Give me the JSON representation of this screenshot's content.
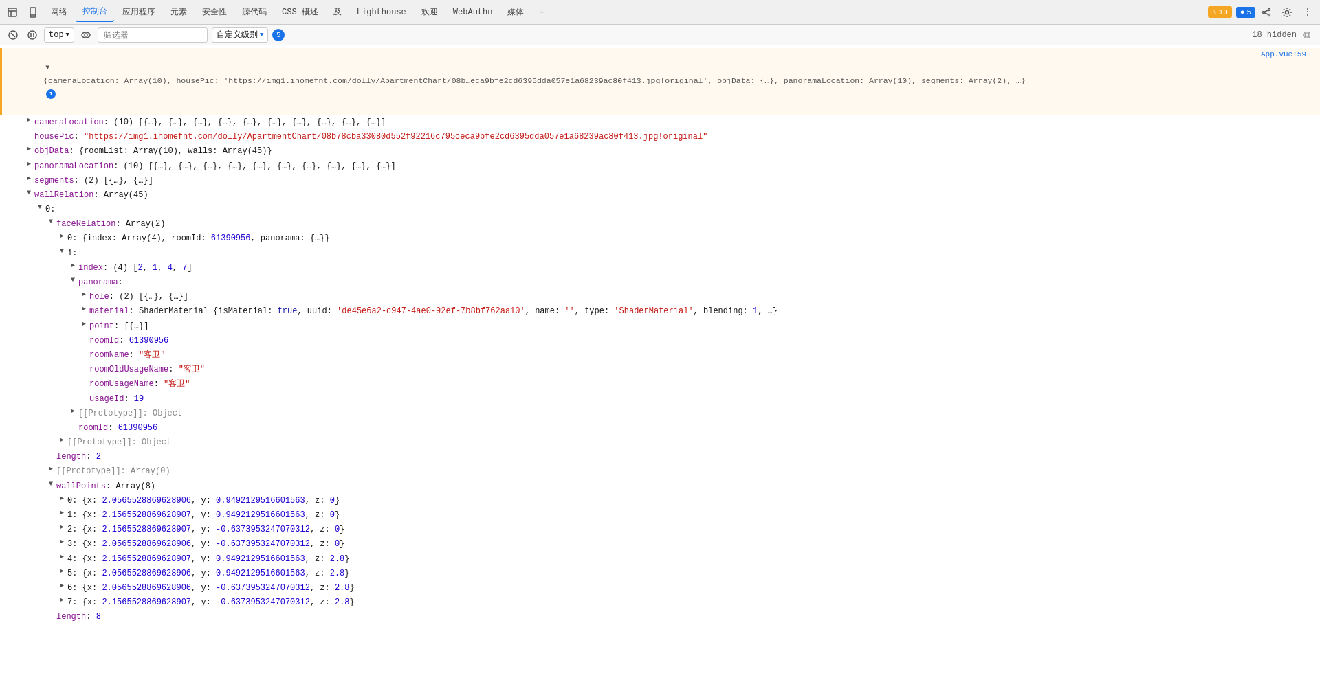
{
  "nav": {
    "items": [
      {
        "label": "网络",
        "active": false
      },
      {
        "label": "控制台",
        "active": true
      },
      {
        "label": "应用程序",
        "active": false
      },
      {
        "label": "元素",
        "active": false
      },
      {
        "label": "安全性",
        "active": false
      },
      {
        "label": "源代码",
        "active": false
      },
      {
        "label": "CSS 概述",
        "active": false
      },
      {
        "label": "及",
        "active": false
      },
      {
        "label": "Lighthouse",
        "active": false
      },
      {
        "label": "欢迎",
        "active": false
      },
      {
        "label": "WebAuthn",
        "active": false
      },
      {
        "label": "媒体",
        "active": false
      }
    ],
    "warning_count": "10",
    "error_count": "5",
    "hidden_count": "18 hidden"
  },
  "toolbar": {
    "top_label": "top",
    "filter_placeholder": "筛选器",
    "level_label": "自定义级别",
    "message_count": "5"
  },
  "source": {
    "link": "App.vue:59"
  },
  "console": {
    "object_summary": "{cameraLocation: Array(10), housePic: 'https://img1.ihomefnt.com/dolly/ApartmentChart/08b…eca9bfe2cd6395dda057e1a68239ac80f413.jpg!original', objData: {…}, panoramaLocation: Array(10), segments: Array(2), …}",
    "lines": [
      {
        "indent": 1,
        "toggle": "open",
        "text": "cameraLocation: (10) [{…}, {…}, {…}, {…}, {…}, {…}, {…}, {…}, {…}, {…}]",
        "key": "cameraLocation",
        "value": "(10) [{…}, {…}, {…}, {…}, {…}, {…}, {…}, {…}, {…}, {…}]"
      },
      {
        "indent": 1,
        "toggle": "none",
        "text": "housePic: \"https://img1.ihomefnt.com/dolly/ApartmentChart/08b78cba33080d552f92216c795ceca9bfe2cd6395dda057e1a68239ac80f413.jpg!original\""
      },
      {
        "indent": 1,
        "toggle": "open",
        "text": "objData: {roomList: Array(10), walls: Array(45)}"
      },
      {
        "indent": 1,
        "toggle": "open",
        "text": "panoramaLocation: (10) [{…}, {…}, {…}, {…}, {…}, {…}, {…}, {…}, {…}, {…}]"
      },
      {
        "indent": 1,
        "toggle": "open",
        "text": "segments: (2) [{…}, {…}]"
      },
      {
        "indent": 1,
        "toggle": "open",
        "text": "wallRelation: Array(45)"
      },
      {
        "indent": 2,
        "toggle": "open",
        "text": "0:"
      },
      {
        "indent": 3,
        "toggle": "open",
        "text": "faceRelation: Array(2)"
      },
      {
        "indent": 4,
        "toggle": "closed",
        "text": "0: {index: Array(4), roomId: 61390956, panorama: {…}}"
      },
      {
        "indent": 4,
        "toggle": "open",
        "text": "1:"
      },
      {
        "indent": 5,
        "toggle": "closed",
        "text": "index: (4) [2, 1, 4, 7]"
      },
      {
        "indent": 5,
        "toggle": "open",
        "text": "panorama:"
      },
      {
        "indent": 6,
        "toggle": "closed",
        "text": "hole: (2) [{…}, {…}]"
      },
      {
        "indent": 6,
        "toggle": "closed",
        "text": "material: ShaderMaterial {isMaterial: true, uuid: 'de45e6a2-c947-4ae0-92ef-7b8bf762aa10', name: '', type: 'ShaderMaterial', blending: 1, …}"
      },
      {
        "indent": 6,
        "toggle": "closed",
        "text": "point: [{…}]"
      },
      {
        "indent": 6,
        "toggle": "none",
        "text": "roomId: 61390956",
        "key": "roomId",
        "is_number": true,
        "number_val": "61390956"
      },
      {
        "indent": 6,
        "toggle": "none",
        "text": "roomName: \"客卫\"",
        "key": "roomName",
        "is_string": true,
        "string_val": "\"客卫\""
      },
      {
        "indent": 6,
        "toggle": "none",
        "text": "roomOldUsageName: \"客卫\"",
        "key": "roomOldUsageName",
        "is_string": true,
        "string_val": "\"客卫\""
      },
      {
        "indent": 6,
        "toggle": "none",
        "text": "roomUsageName: \"客卫\"",
        "key": "roomUsageName",
        "is_string": true,
        "string_val": "\"客卫\""
      },
      {
        "indent": 6,
        "toggle": "none",
        "text": "usageId: 19",
        "key": "usageId",
        "is_number": true,
        "number_val": "19"
      },
      {
        "indent": 5,
        "toggle": "closed",
        "text": "[[Prototype]]: Object"
      },
      {
        "indent": 5,
        "toggle": "none",
        "text": "roomId: 61390956",
        "key": "roomId",
        "is_number": true,
        "number_val": "61390956"
      },
      {
        "indent": 4,
        "toggle": "closed",
        "text": "[[Prototype]]: Object"
      },
      {
        "indent": 3,
        "toggle": "none",
        "text": "length: 2"
      },
      {
        "indent": 3,
        "toggle": "closed",
        "text": "[[Prototype]]: Array(0)"
      },
      {
        "indent": 3,
        "toggle": "open",
        "text": "wallPoints: Array(8)"
      },
      {
        "indent": 4,
        "toggle": "closed",
        "text": "0: {x: 2.0565528869628906, y: 0.9492129516601563, z: 0}"
      },
      {
        "indent": 4,
        "toggle": "closed",
        "text": "1: {x: 2.1565528869628907, y: 0.9492129516601563, z: 0}"
      },
      {
        "indent": 4,
        "toggle": "closed",
        "text": "2: {x: 2.1565528869628907, y: -0.6373953247070312, z: 0}"
      },
      {
        "indent": 4,
        "toggle": "closed",
        "text": "3: {x: 2.0565528869628906, y: -0.6373953247070312, z: 0}"
      },
      {
        "indent": 4,
        "toggle": "closed",
        "text": "4: {x: 2.1565528869628907, y: 0.9492129516601563, z: 2.8}"
      },
      {
        "indent": 4,
        "toggle": "closed",
        "text": "5: {x: 2.0565528869628906, y: 0.9492129516601563, z: 2.8}"
      },
      {
        "indent": 4,
        "toggle": "closed",
        "text": "6: {x: 2.0565528869628906, y: -0.6373953247070312, z: 2.8}"
      },
      {
        "indent": 4,
        "toggle": "closed",
        "text": "7: {x: 2.1565528869628907, y: -0.6373953247070312, z: 2.8}"
      },
      {
        "indent": 3,
        "toggle": "none",
        "text": "length: 8"
      }
    ]
  }
}
